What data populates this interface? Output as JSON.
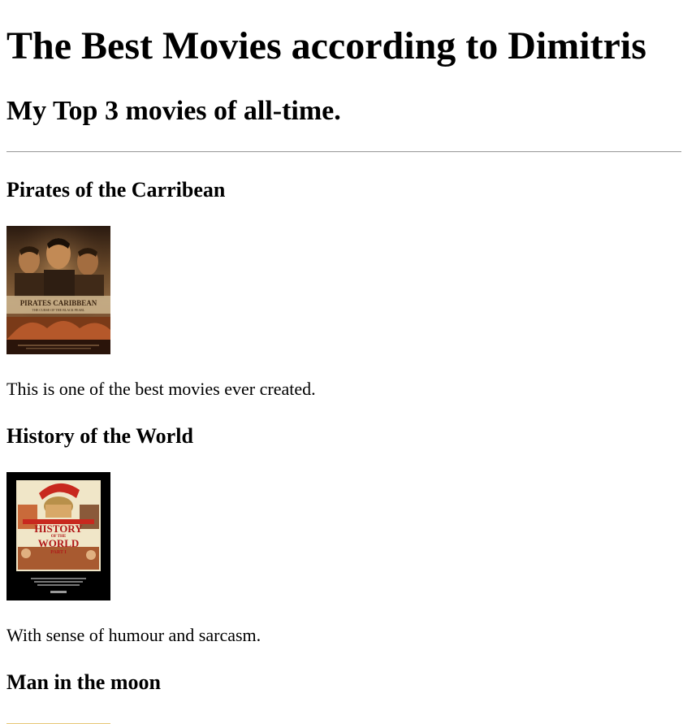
{
  "page": {
    "title": "The Best Movies according to Dimitris",
    "subtitle": "My Top 3 movies of all-time."
  },
  "movies": [
    {
      "title": "Pirates of the Carribean",
      "description": "This is one of the best movies ever created.",
      "poster_text": "PIRATES CARIBBEAN",
      "poster_subtext": "THE CURSE OF THE BLACK PEARL"
    },
    {
      "title": "History of the World",
      "description": "With sense of humour and sarcasm.",
      "poster_text_1": "HISTORY",
      "poster_text_2": "OF THE",
      "poster_text_3": "WORLD",
      "poster_text_4": "PART I"
    },
    {
      "title": "Man in the moon"
    }
  ]
}
